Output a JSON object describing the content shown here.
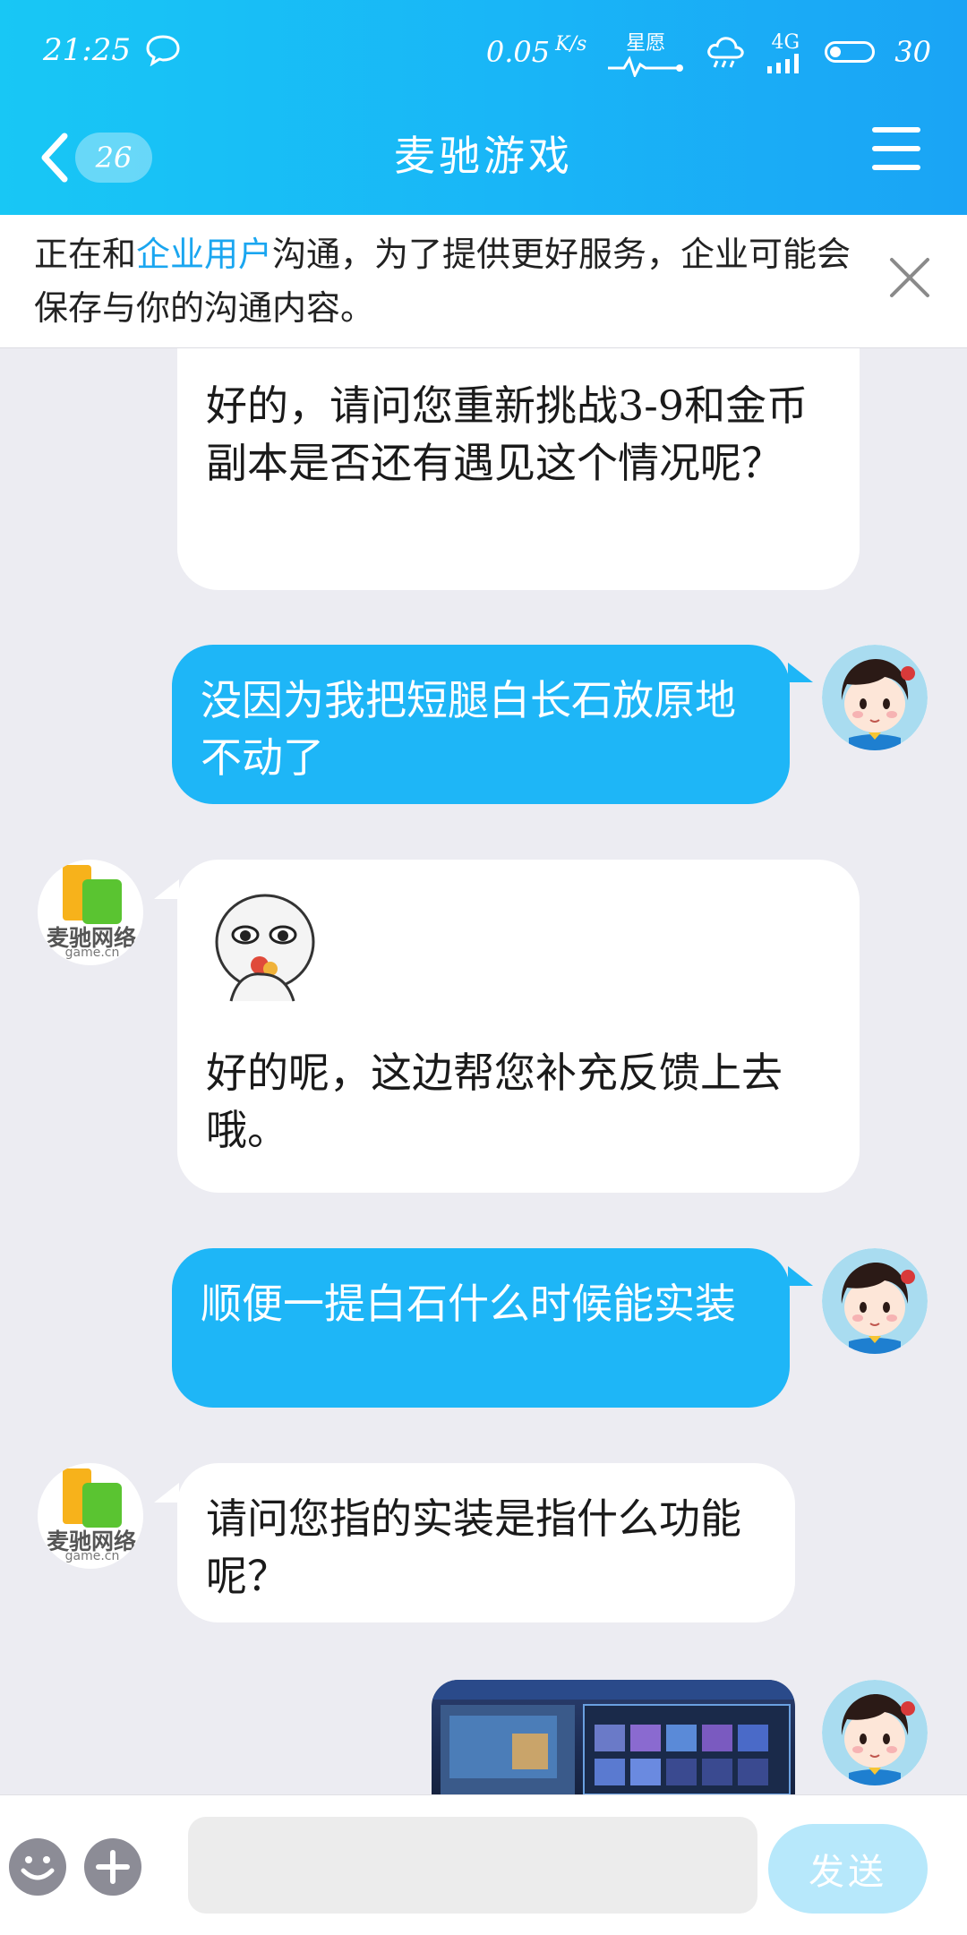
{
  "status_bar": {
    "time": "21:25",
    "net_speed": "0.05",
    "net_unit": "K/s",
    "carrier_tag": "星愿",
    "signal_tag": "4G",
    "battery": "30",
    "icons": [
      "message-icon",
      "activity-icon",
      "cloud-rain-icon",
      "signal-icon",
      "battery-icon"
    ]
  },
  "header": {
    "title": "麦驰游戏",
    "back_badge": "26",
    "icons": [
      "back-icon",
      "menu-icon"
    ]
  },
  "notice": {
    "prefix": "正在和",
    "highlight": "企业用户",
    "suffix": "沟通，为了提供更好服务，企业可能会保存与你的沟通内容。"
  },
  "messages": [
    {
      "side": "in",
      "text": "好的，请问您重新挑战3-9和金币副本是否还有遇见这个情况呢？"
    },
    {
      "side": "out",
      "text": "没因为我把短腿白长石放原地不动了"
    },
    {
      "side": "in",
      "text": "好的呢，这边帮您补充反馈上去哦。",
      "has_sticker": true
    },
    {
      "side": "out",
      "text": "顺便一提白石什么时候能实装"
    },
    {
      "side": "in",
      "text": "请问您指的实装是指什么功能呢？"
    },
    {
      "side": "out",
      "type": "image"
    }
  ],
  "business_logo": {
    "name": "麦驰网络",
    "sub": "game.cn"
  },
  "input_bar": {
    "placeholder": "",
    "send_label": "发送",
    "icons": [
      "emoji-icon",
      "plus-icon"
    ]
  },
  "colors": {
    "header": "#1ab4f6",
    "outgoing_bubble": "#1eb6f7",
    "incoming_bubble": "#ffffff",
    "background": "#ececf2",
    "send_button": "#b7e8fb"
  }
}
